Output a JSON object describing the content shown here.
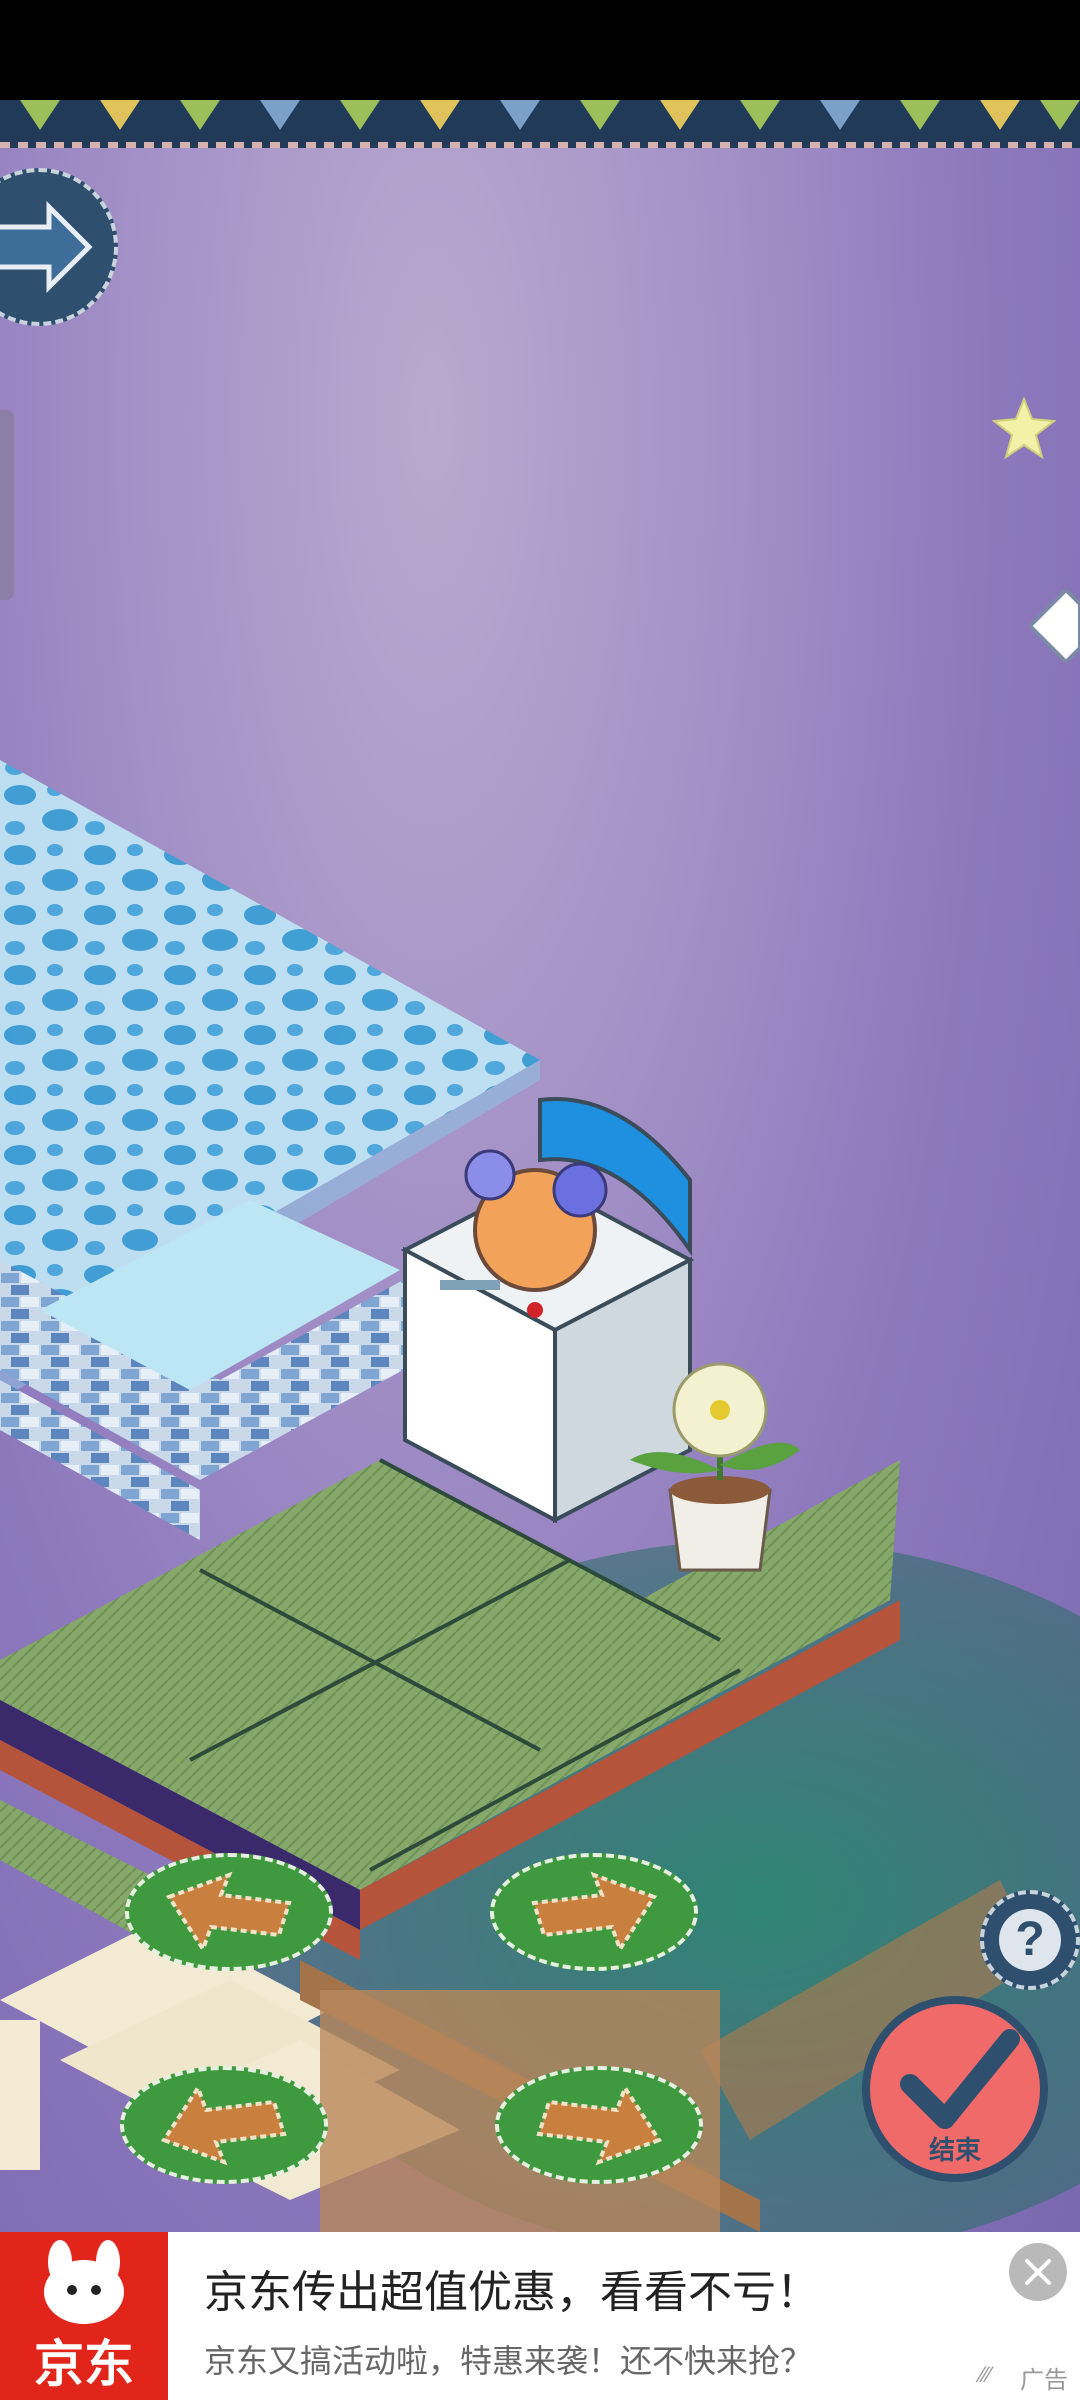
{
  "game": {
    "end_button_label": "结束",
    "help_symbol": "?"
  },
  "ad": {
    "brand": "京东",
    "title": "京东传出超值优惠，看看不亏！",
    "description": "京东又搞活动啦，特惠来袭！还不快来抢？",
    "tag": "广告",
    "tag_icon": "ad-mark-icon",
    "brand_color": "#e1251b"
  }
}
